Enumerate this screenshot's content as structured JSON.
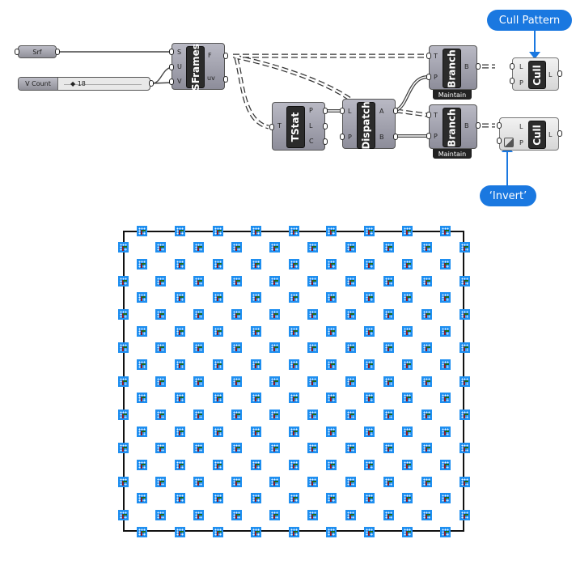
{
  "components": {
    "srf": {
      "label": "Srf"
    },
    "v_count": {
      "label": "V Count",
      "value": "18"
    },
    "sframes": {
      "name": "SFrames",
      "inputs": [
        "S",
        "U",
        "V"
      ],
      "outputs": [
        "F",
        "uv"
      ]
    },
    "tstat": {
      "name": "TStat",
      "inputs": [
        "T"
      ],
      "outputs": [
        "P",
        "L",
        "C"
      ]
    },
    "dispatch": {
      "name": "Dispatch",
      "inputs": [
        "L",
        "P"
      ],
      "outputs": [
        "A",
        "B"
      ]
    },
    "branch_top": {
      "name": "Branch",
      "inputs": [
        "T",
        "P"
      ],
      "outputs": [
        "B"
      ],
      "badge": "Maintain"
    },
    "branch_bottom": {
      "name": "Branch",
      "inputs": [
        "T",
        "P"
      ],
      "outputs": [
        "B"
      ],
      "badge": "Maintain"
    },
    "cull_top": {
      "name": "Cull",
      "inputs": [
        "L",
        "P"
      ],
      "outputs": [
        "L"
      ]
    },
    "cull_bottom": {
      "name": "Cull",
      "inputs": [
        "L",
        "P"
      ],
      "outputs": [
        "L"
      ],
      "input_flag": "invert"
    }
  },
  "callouts": {
    "cull_pattern": "Cull Pattern",
    "invert": "‘Invert’"
  },
  "viewport": {
    "grid_rows": 19,
    "row_columns_pattern": [
      9,
      10
    ],
    "colors": {
      "frame": "#1f8ff0",
      "y_axis": "#8b1a2b",
      "x_axis": "#1e6b1e",
      "callout": "#1a78e0"
    }
  }
}
